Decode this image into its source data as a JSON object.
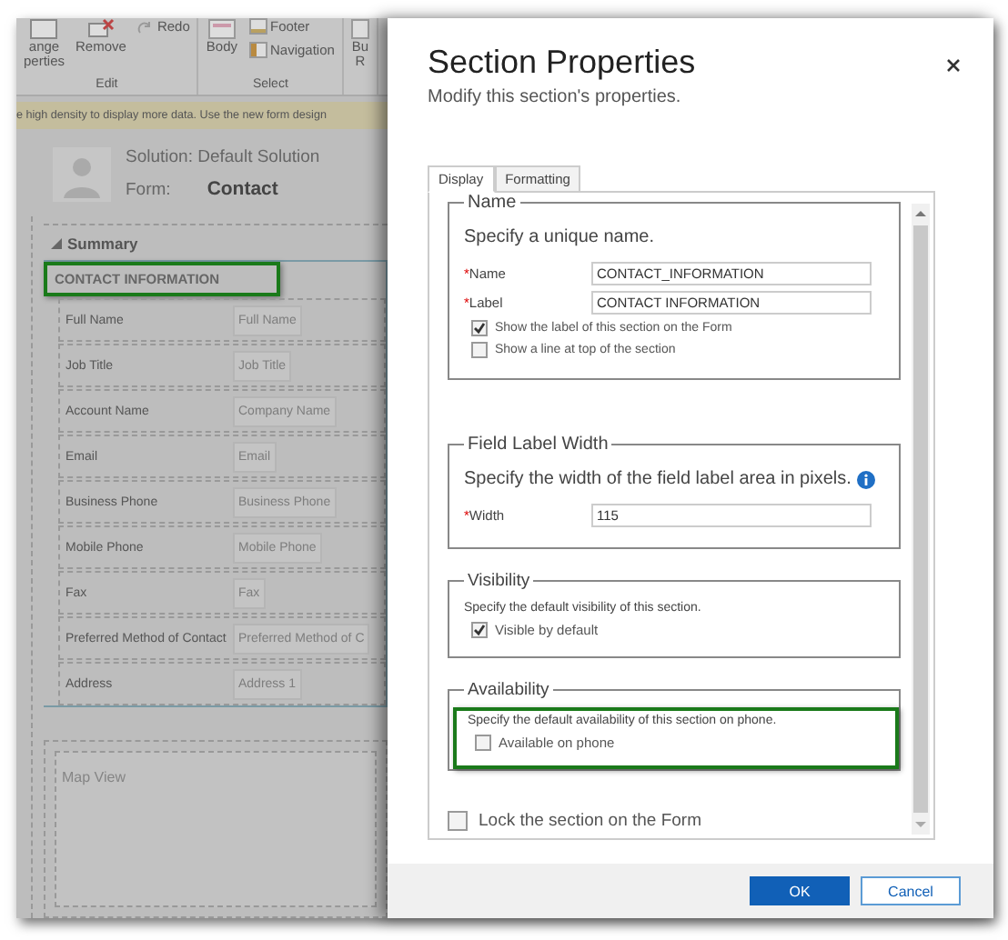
{
  "ribbon": {
    "groups": [
      {
        "label": "Edit",
        "buttons": [
          {
            "kind": "large",
            "lines": [
              "ange",
              "perties"
            ]
          },
          {
            "kind": "large",
            "lines": [
              "Remove"
            ]
          },
          {
            "kind": "small",
            "lines": [
              "Redo"
            ]
          }
        ]
      },
      {
        "label": "Select",
        "buttons": [
          {
            "kind": "large",
            "lines": [
              "Body"
            ]
          },
          {
            "kind": "small",
            "lines": [
              "Footer"
            ]
          },
          {
            "kind": "small",
            "lines": [
              "Navigation"
            ]
          }
        ]
      },
      {
        "buttons": [
          {
            "kind": "large",
            "lines": [
              "Bu",
              "R"
            ]
          }
        ]
      }
    ]
  },
  "notice": "e high density to display more data. Use the new form design",
  "form_header": {
    "solution": "Solution: Default Solution",
    "form_label": "Form:",
    "form_name": "Contact"
  },
  "tab": {
    "label": "Summary",
    "expanded": true
  },
  "section": {
    "label": "CONTACT INFORMATION",
    "highlighted": true
  },
  "fields": [
    {
      "label": "Full Name",
      "placeholder": "Full Name"
    },
    {
      "label": "Job Title",
      "placeholder": "Job Title"
    },
    {
      "label": "Account Name",
      "placeholder": "Company Name"
    },
    {
      "label": "Email",
      "placeholder": "Email"
    },
    {
      "label": "Business Phone",
      "placeholder": "Business Phone"
    },
    {
      "label": "Mobile Phone",
      "placeholder": "Mobile Phone"
    },
    {
      "label": "Fax",
      "placeholder": "Fax"
    },
    {
      "label": "Preferred Method of Contact",
      "placeholder": "Preferred Method of C"
    },
    {
      "label": "Address",
      "placeholder": "Address 1"
    }
  ],
  "map_section": {
    "label": "Map View"
  },
  "dialog": {
    "title": "Section Properties",
    "subtitle": "Modify this section's properties.",
    "tabs": [
      {
        "label": "Display",
        "selected": true
      },
      {
        "label": "Formatting",
        "selected": false
      }
    ],
    "groups": [
      {
        "kind": "large",
        "legend": "Name",
        "hint": "Specify a unique name.",
        "highlighted": false,
        "inputs": [
          {
            "mark": "*",
            "label": "Name",
            "value": "CONTACT_INFORMATION"
          },
          {
            "mark": "*",
            "label": "Label",
            "value": "CONTACT INFORMATION"
          }
        ],
        "options": [
          {
            "label": "Show the label of this section on the Form",
            "checked": true
          },
          {
            "label": "Show a line at top of the section",
            "checked": false
          }
        ]
      },
      {
        "kind": "large",
        "legend": "Field Label Width",
        "hint": "Specify the width of the field label area in pixels.",
        "info": true,
        "highlighted": false,
        "inputs": [
          {
            "mark": "*",
            "label": "Width",
            "value": "115"
          }
        ]
      },
      {
        "kind": "small",
        "legend": "Visibility",
        "hint": "Specify the default visibility of this section.",
        "highlighted": false,
        "options": [
          {
            "label": "Visible by default",
            "checked": true
          }
        ]
      },
      {
        "kind": "small",
        "legend": "Availability",
        "hint": "Specify the default availability of this section on phone.",
        "highlighted": true,
        "options": [
          {
            "label": "Available on phone",
            "checked": false
          }
        ]
      }
    ],
    "lock": {
      "label": "Lock the section on the Form",
      "checked": false
    },
    "buttons": [
      {
        "label": "OK",
        "primary": true
      },
      {
        "label": "Cancel",
        "primary": false
      }
    ]
  }
}
